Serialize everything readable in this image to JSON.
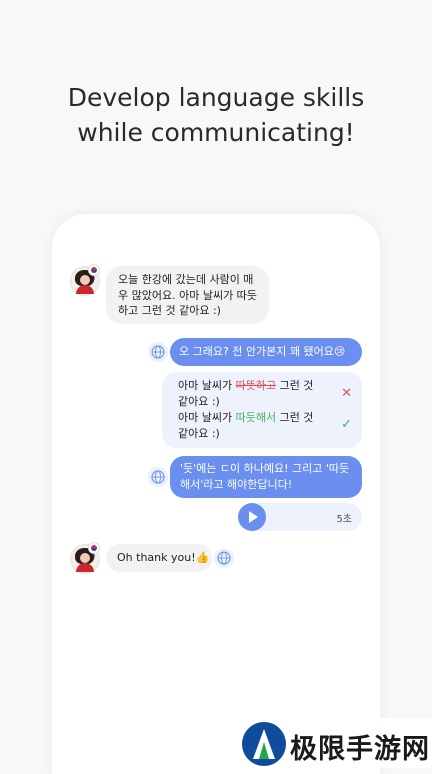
{
  "headline": {
    "line1": "Develop language skills",
    "line2": "while communicating!"
  },
  "chat": {
    "msg1": {
      "line1": "오늘 한강에 갔는데 사람이 매",
      "line2": "우 많았어요. 아마 날씨가 따듯",
      "line3": "하고 그런 것 같아요 :)"
    },
    "msg2": {
      "text": "오 그래요? 전 안가본지 꽤 됐어요😢"
    },
    "correction": {
      "wrong": {
        "prefix": "아마 날씨가 ",
        "error": "따뜻하고",
        "suffix": " 그런 것",
        "line2": "같아요 :)"
      },
      "right": {
        "prefix": "아마 날씨가 ",
        "fix": "따듯해서",
        "suffix": " 그런 것",
        "line2": "같아요 :)"
      },
      "wrong_mark": "✕",
      "right_mark": "✓"
    },
    "msg3": {
      "line1": "'듯'에는 ㄷ이 하나예요! 그리고 '따듯",
      "line2": "해서'라고 해야한답니다!"
    },
    "audio": {
      "duration": "5초"
    },
    "msg4": {
      "text": "Oh thank you!👍"
    }
  },
  "watermark": {
    "text": "极限手游网"
  },
  "colors": {
    "accent": "#6a8ff0",
    "bubble_in": "#f1f2f4",
    "correction_bg": "#eef2fc",
    "error": "#e24d55",
    "fix": "#3fb35c"
  }
}
